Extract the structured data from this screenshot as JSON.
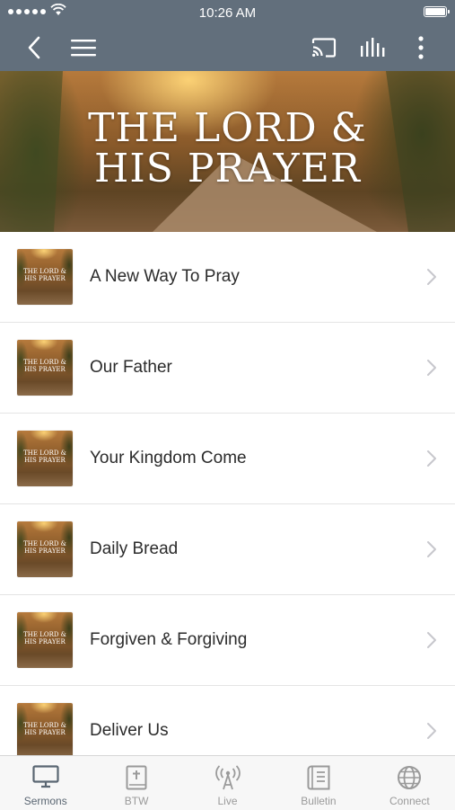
{
  "status_bar": {
    "time": "10:26 AM"
  },
  "app_bar": {
    "icons": [
      "back-icon",
      "menu-icon",
      "cast-icon",
      "audio-bars-icon",
      "more-vert-icon"
    ]
  },
  "banner": {
    "title_line1": "THE LORD &",
    "title_line2": "HIS PRAYER"
  },
  "sermons": [
    {
      "title": "A New Way To Pray",
      "thumb_line1": "THE LORD &",
      "thumb_line2": "HIS PRAYER"
    },
    {
      "title": "Our Father",
      "thumb_line1": "THE LORD &",
      "thumb_line2": "HIS PRAYER"
    },
    {
      "title": "Your Kingdom Come",
      "thumb_line1": "THE LORD &",
      "thumb_line2": "HIS PRAYER"
    },
    {
      "title": "Daily Bread",
      "thumb_line1": "THE LORD &",
      "thumb_line2": "HIS PRAYER"
    },
    {
      "title": "Forgiven & Forgiving",
      "thumb_line1": "THE LORD &",
      "thumb_line2": "HIS PRAYER"
    },
    {
      "title": "Deliver Us",
      "thumb_line1": "THE LORD &",
      "thumb_line2": "HIS PRAYER"
    }
  ],
  "tabs": [
    {
      "label": "Sermons",
      "icon": "monitor-icon",
      "active": true
    },
    {
      "label": "BTW",
      "icon": "bible-icon",
      "active": false
    },
    {
      "label": "Live",
      "icon": "broadcast-icon",
      "active": false
    },
    {
      "label": "Bulletin",
      "icon": "bulletin-icon",
      "active": false
    },
    {
      "label": "Connect",
      "icon": "globe-icon",
      "active": false
    }
  ],
  "colors": {
    "app_bar": "#626f7c",
    "active_tab": "#5a6672",
    "inactive_tab": "#9a9a9a",
    "row_text": "#2b2b2b"
  }
}
